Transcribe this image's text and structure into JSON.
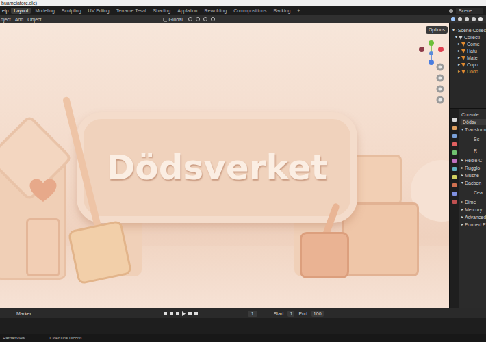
{
  "window": {
    "title": "buameiatorc.dle)"
  },
  "menu": [
    "elp"
  ],
  "workspaces": [
    {
      "label": "Layout",
      "selected": true
    },
    {
      "label": "Modeling",
      "selected": false
    },
    {
      "label": "Sculpting",
      "selected": false
    },
    {
      "label": "UV Ediing",
      "selected": false
    },
    {
      "label": "Terrame Tesal",
      "selected": false
    },
    {
      "label": "Shading",
      "selected": false
    },
    {
      "label": "Applation",
      "selected": false
    },
    {
      "label": "Rewolding",
      "selected": false
    },
    {
      "label": "Commpositions",
      "selected": false
    },
    {
      "label": "Backing",
      "selected": false
    },
    {
      "label": "+",
      "selected": false
    }
  ],
  "scene": "Scene",
  "header": {
    "items": [
      "oject",
      "Add",
      "Object"
    ],
    "orientation": "Global",
    "options": "Options"
  },
  "viewport": {
    "sign_text": "Dödsverket"
  },
  "outliner": {
    "items": [
      {
        "label": "Scene Collec",
        "expanded": true,
        "selected": false
      },
      {
        "label": "Collecti",
        "expanded": true,
        "selected": false
      },
      {
        "label": "Come",
        "expanded": false,
        "selected": false
      },
      {
        "label": "Hatu",
        "expanded": false,
        "selected": false
      },
      {
        "label": "Mate",
        "expanded": false,
        "selected": false
      },
      {
        "label": "Copo",
        "expanded": false,
        "selected": false
      },
      {
        "label": "Dödo",
        "expanded": false,
        "selected": true
      }
    ]
  },
  "properties": {
    "title": "Console",
    "object": "Dödsv",
    "sections": [
      {
        "label": "Transform",
        "expanded": true
      },
      {
        "label": "Sc",
        "expanded": false
      },
      {
        "label": "R",
        "expanded": false
      },
      {
        "label": "Redie C",
        "expanded": false
      },
      {
        "label": "Rugglo",
        "expanded": false
      },
      {
        "label": "Mushe",
        "expanded": false
      },
      {
        "label": "Dacben",
        "expanded": true
      },
      {
        "label": "Cea",
        "expanded": false
      },
      {
        "label": "Dime",
        "expanded": false
      },
      {
        "label": "Mercury",
        "expanded": false
      },
      {
        "label": "Advanced",
        "expanded": false
      },
      {
        "label": "Formed P",
        "expanded": false
      }
    ]
  },
  "timeline": {
    "items": [
      "Marker"
    ],
    "frame": "1",
    "start_label": "Start",
    "start": "1",
    "end_label": "End",
    "end": "100"
  },
  "status_bar": {
    "items": [
      "RardanView",
      "Clder Dos Dlccon"
    ]
  }
}
